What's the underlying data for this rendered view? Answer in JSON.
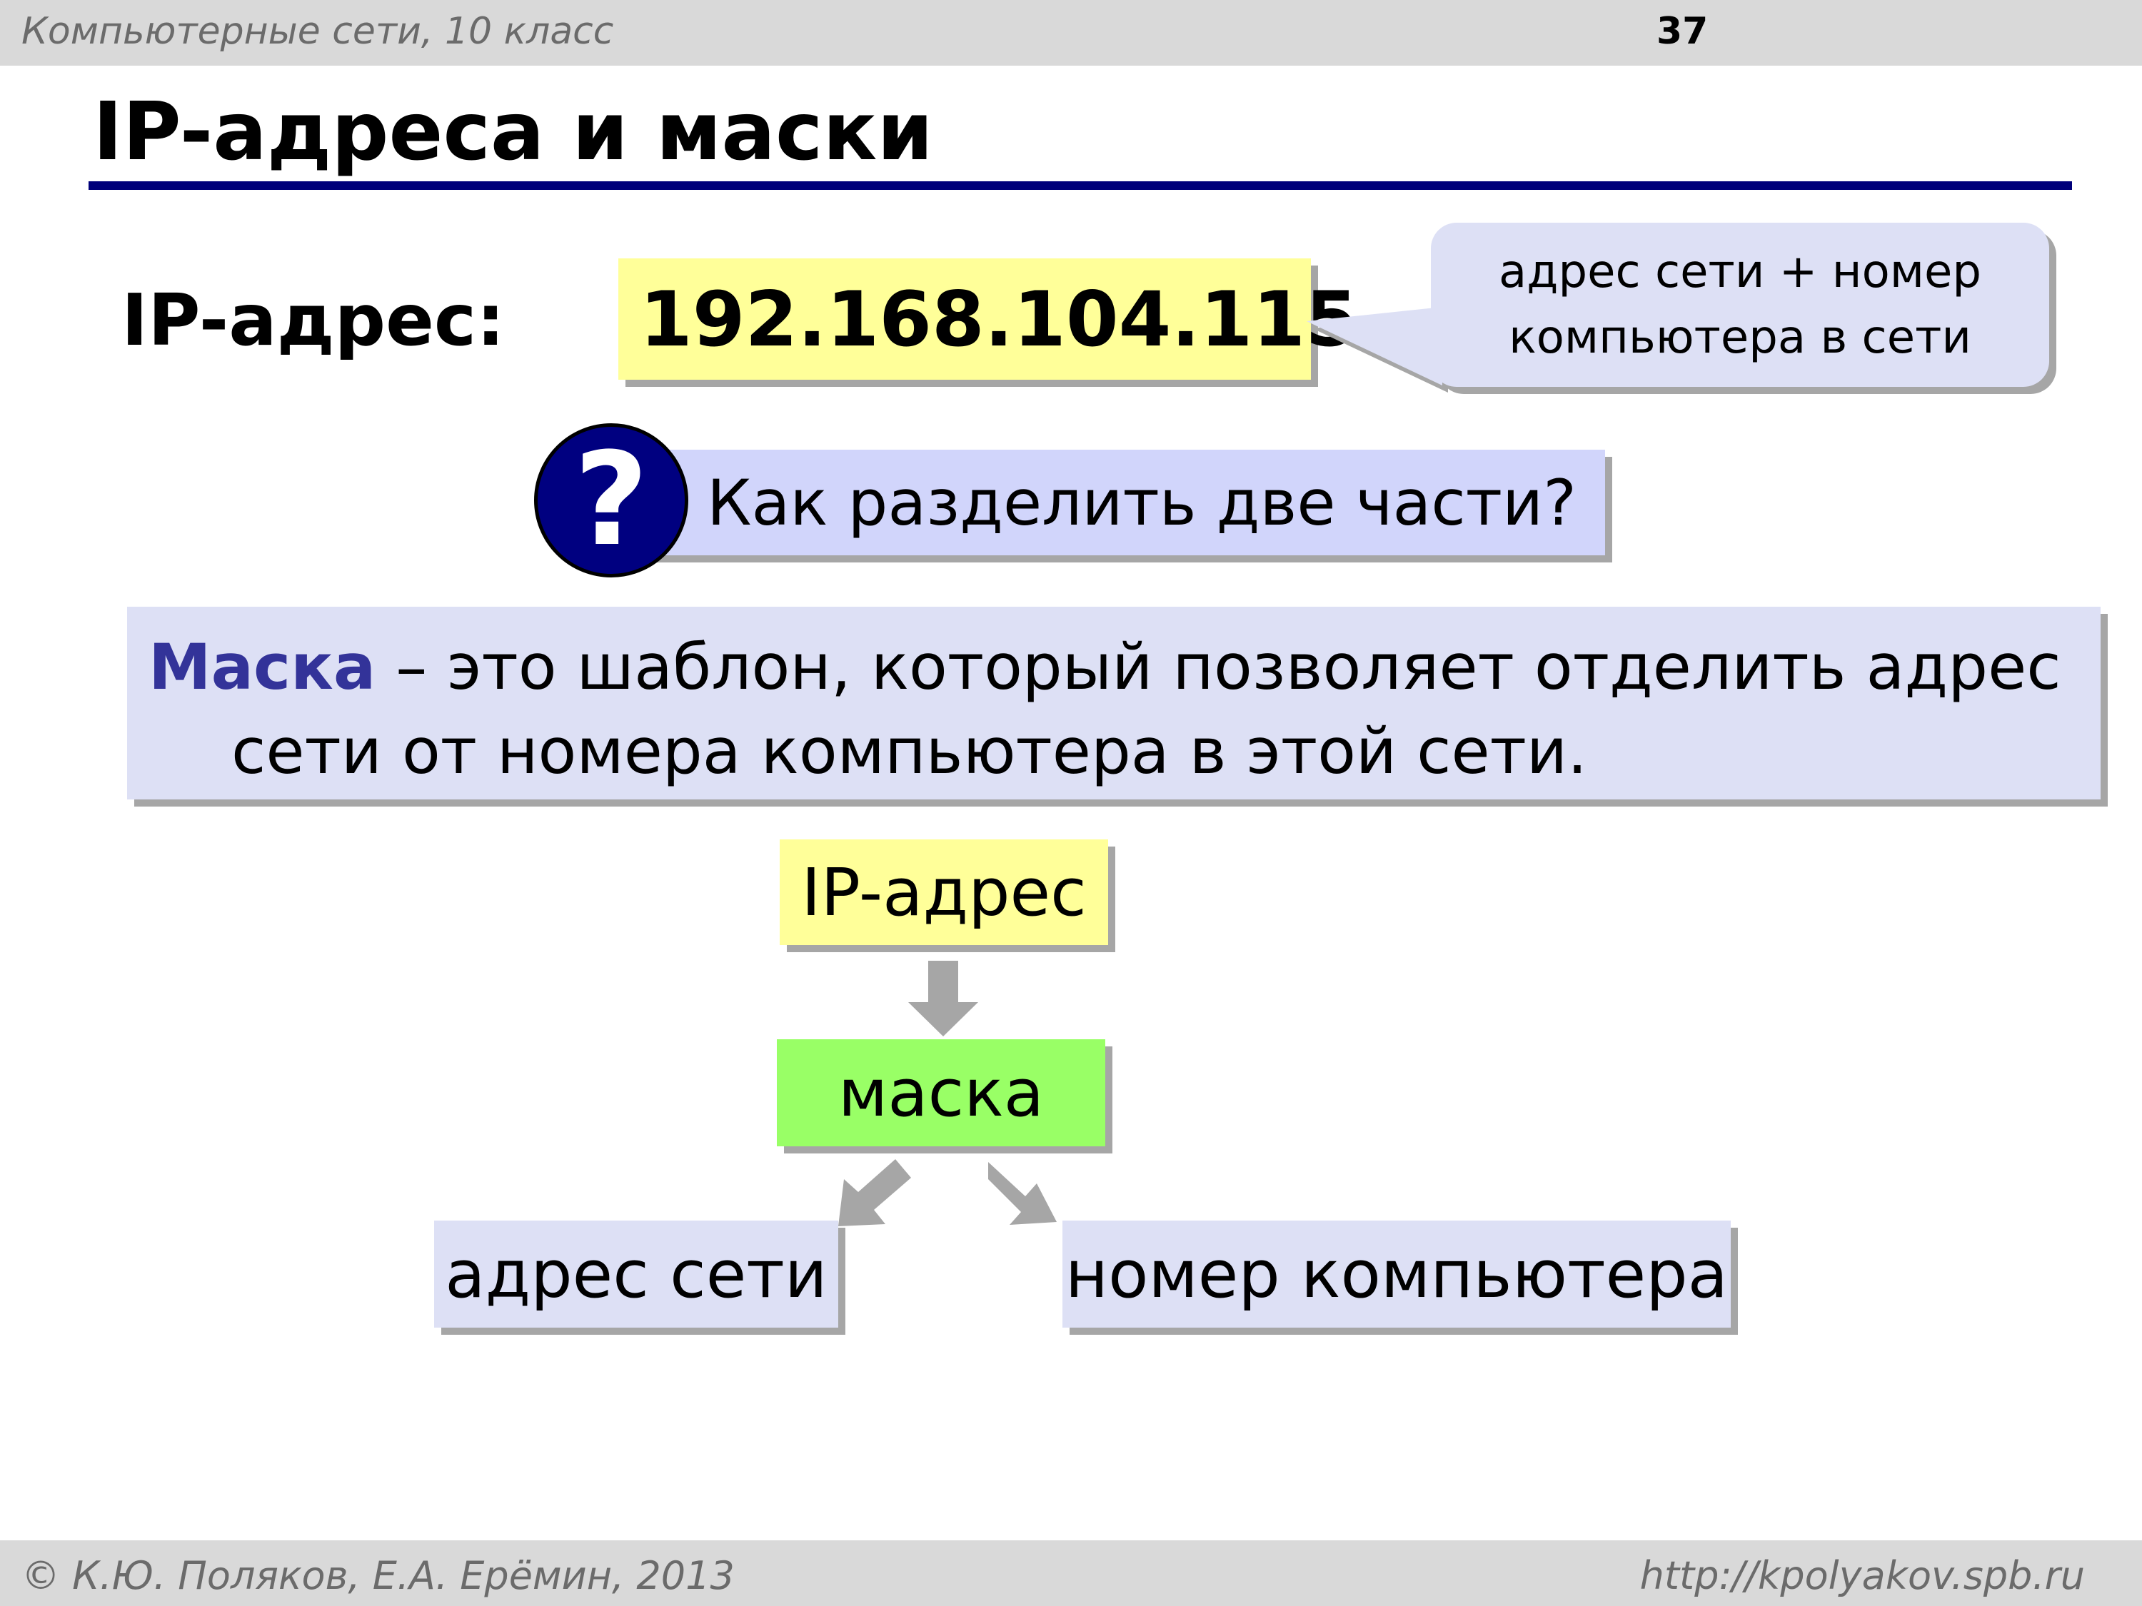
{
  "header": {
    "course": "Компьютерные сети, 10 класс",
    "page_number": "37"
  },
  "title": "IP-адреса и маски",
  "ip": {
    "label": "IP-адрес:",
    "value": "192.168.104.115"
  },
  "callout": {
    "line1": "адрес сети + номер",
    "line2": "компьютера в сети"
  },
  "question": {
    "icon": "?",
    "text": "Как разделить две части?"
  },
  "definition": {
    "term": "Маска",
    "rest_line1": " – это шаблон, который позволяет отделить адрес",
    "line2": "сети от номера компьютера в этой сети."
  },
  "diagram": {
    "ip_node": "IP-адрес",
    "mask_node": "маска",
    "network_node": "адрес сети",
    "host_node": "номер компьютера"
  },
  "footer": {
    "authors": "© К.Ю. Поляков, Е.А. Ерёмин, 2013",
    "url": "http://kpolyakov.spb.ru"
  },
  "colors": {
    "title_rule": "#00007a",
    "ip_box": "#ffff99",
    "lavender": "#dde0f5",
    "mask_node": "#99ff66",
    "question_badge": "#000080",
    "definition_term": "#333399",
    "arrow": "#a6a6a6"
  }
}
